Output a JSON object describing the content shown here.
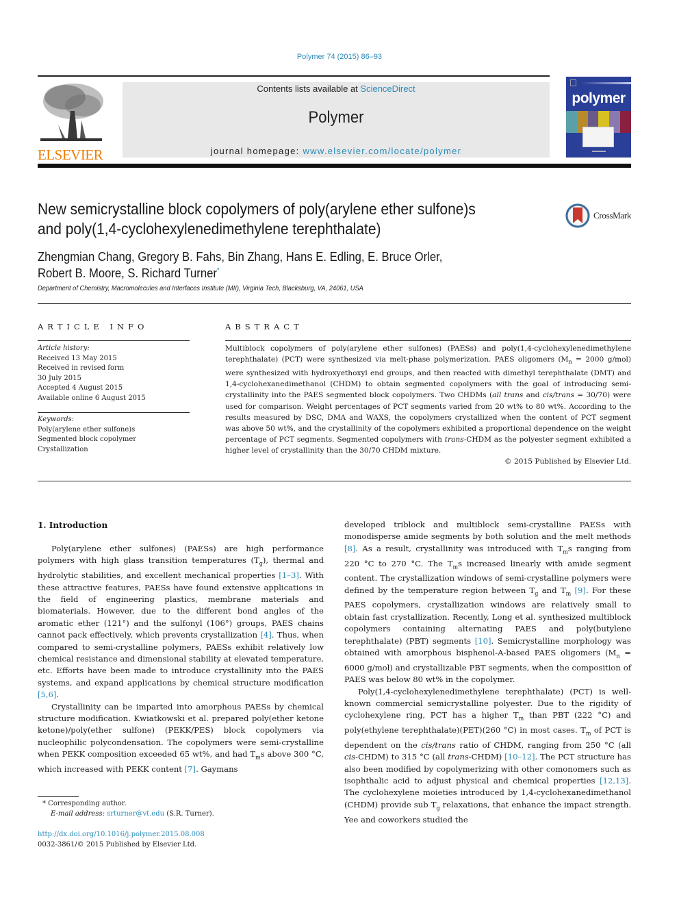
{
  "header": {
    "citation": "Polymer 74 (2015) 86–93",
    "contents_prefix": "Contents lists available at ",
    "contents_link": "ScienceDirect",
    "journal_name": "Polymer",
    "homepage_prefix": "journal homepage: ",
    "homepage_link": "www.elsevier.com/locate/polymer",
    "publisher_logo_text": "ELSEVIER",
    "cover_title": "polymer",
    "colors": {
      "link": "#2a8ab8",
      "elsevier_orange": "#f07d00",
      "cover_blue": "#2a3f98"
    }
  },
  "article": {
    "title_line1": "New semicrystalline block copolymers of poly(arylene ether sulfone)s",
    "title_line2": "and poly(1,4-cyclohexylenedimethylene terephthalate)",
    "crossmark_label": "CrossMark",
    "authors_line1": "Zhengmian Chang, Gregory B. Fahs, Bin Zhang, Hans E. Edling, E. Bruce Orler,",
    "authors_line2": "Robert B. Moore, S. Richard Turner",
    "corresponding_mark": "*",
    "affiliation": "Department of Chemistry, Macromolecules and Interfaces Institute (MII), Virginia Tech, Blacksburg, VA, 24061, USA"
  },
  "article_info": {
    "heading": "ARTICLE INFO",
    "history_label": "Article history:",
    "history": [
      "Received 13 May 2015",
      "Received in revised form",
      "30 July 2015",
      "Accepted 4 August 2015",
      "Available online 6 August 2015"
    ],
    "keywords_label": "Keywords:",
    "keywords": [
      "Poly(arylene ether sulfone)s",
      "Segmented block copolymer",
      "Crystallization"
    ]
  },
  "abstract": {
    "heading": "ABSTRACT",
    "p1": "Multiblock copolymers of poly(arylene ether sulfones) (PAESs) and poly(1,4-cyclohexylenedimethylene terephthalate) (PCT) were synthesized via melt-phase polymerization. PAES oligomers (M",
    "p1_sub": "n",
    "p2": " = 2000 g/mol) were synthesized with hydroxyethoxyl end groups, and then reacted with dimethyl terephthalate (DMT) and 1,4-cyclohexanedimethanol (CHDM) to obtain segmented copolymers with the goal of introducing semi-crystallinity into the PAES segmented block copolymers. Two CHDMs (",
    "p2_ital": "all trans",
    "p3": " and ",
    "p3_ital": "cis/trans",
    "p4": " = 30/70) were used for comparison. Weight percentages of PCT segments varied from 20 wt% to 80 wt%. According to the results measured by DSC, DMA and WAXS, the copolymers crystallized when the content of PCT segment was above 50 wt%, and the crystallinity of the copolymers exhibited a proportional dependence on the weight percentage of PCT segments. Segmented copolymers with ",
    "p4_ital": "trans",
    "p5": "-CHDM as the polyester segment exhibited a higher level of crystallinity than the 30/70 CHDM mixture.",
    "copyright": "© 2015 Published by Elsevier Ltd."
  },
  "body": {
    "section_heading": "1.  Introduction",
    "left": {
      "a1": "Poly(arylene ether sulfones) (PAESs) are high performance polymers with high glass transition temperatures (T",
      "a1_sub": "g",
      "a2": "), thermal and hydrolytic stabilities, and excellent mechanical properties ",
      "a2_ref": "[1–3]",
      "a3": ". With these attractive features, PAESs have found extensive applications in the field of engineering plastics, membrane materials and biomaterials. However, due to the different bond angles of the aromatic ether (121°) and the sulfonyl (106°) groups, PAES chains cannot pack effectively, which prevents crystallization ",
      "a3_ref": "[4]",
      "a4": ". Thus, when compared to semi-crystalline polymers, PAESs exhibit relatively low chemical resistance and dimensional stability at elevated temperature, etc. Efforts have been made to introduce crystallinity into the PAES systems, and expand applications by chemical structure modification ",
      "a4_ref": "[5,6]",
      "a5": ".",
      "b1": "Crystallinity can be imparted into amorphous PAESs by chemical structure modification. Kwiatkowski et al. prepared poly(ether ketone ketone)/poly(ether sulfone) (PEKK/PES) block copolymers via nucleophilic polycondensation. The copolymers were semi-crystalline when PEKK composition exceeded 65 wt%, and had T",
      "b1_sub": "m",
      "b2": "s above 300 °C, which increased with PEKK content ",
      "b2_ref": "[7]",
      "b3": ". Gaymans"
    },
    "right": {
      "a1": "developed triblock and multiblock semi-crystalline PAESs with monodisperse amide segments by both solution and the melt methods ",
      "a1_ref": "[8]",
      "a2": ". As a result, crystallinity was introduced with T",
      "a2_sub": "m",
      "a3": "s ranging from 220 °C to 270 °C. The T",
      "a3_sub": "m",
      "a4": "s increased linearly with amide segment content. The crystallization windows of semi-crystalline polymers were defined by the temperature region between T",
      "a4_sub": "g",
      "a5": " and T",
      "a5_sub": "m",
      "a5b": " ",
      "a5_ref": "[9]",
      "a6": ". For these PAES copolymers, crystallization windows are relatively small to obtain fast crystallization. Recently, Long et al. synthesized multiblock copolymers containing alternating PAES and poly(butylene terephthalate) (PBT) segments ",
      "a6_ref": "[10]",
      "a7": ". Semicrystalline morphology was obtained with amorphous bisphenol-A-based PAES oligomers (M",
      "a7_sub": "n",
      "a8": " = 6000 g/mol) and crystallizable PBT segments, when the composition of PAES was below 80 wt% in the copolymer.",
      "b1": "Poly(1,4-cyclohexylenedimethylene terephthalate) (PCT) is well-known commercial semicrystalline polyester. Due to the rigidity of cyclohexylene ring, PCT has a higher T",
      "b1_sub": "m",
      "b2": " than PBT (222 °C) and poly(ethylene terephthalate)(PET)(260 °C) in most cases. T",
      "b2_sub": "m",
      "b3": " of PCT is dependent on the ",
      "b3_ital": "cis/trans",
      "b4": " ratio of CHDM, ranging from 250 °C (all ",
      "b4_ital": "cis",
      "b5": "-CHDM) to 315 °C (all ",
      "b5_ital": "trans",
      "b6": "-CHDM) ",
      "b6_ref": "[10–12]",
      "b7": ". The PCT structure has also been modified by copolymerizing with other comonomers such as isophthalic acid to adjust physical and chemical properties ",
      "b7_ref": "[12,13]",
      "b8": ". The cyclohexylene moieties introduced by 1,4-cyclohexanedimethanol (CHDM) provide sub T",
      "b8_sub": "g",
      "b9": " relaxations, that enhance the impact strength. Yee and coworkers studied the"
    }
  },
  "footnote": {
    "mark": "*",
    "corresponding": " Corresponding author.",
    "email_label": "E-mail address:",
    "email": "srturner@vt.edu",
    "email_suffix": " (S.R. Turner).",
    "doi": "http://dx.doi.org/10.1016/j.polymer.2015.08.008",
    "issn_line": "0032-3861/© 2015 Published by Elsevier Ltd."
  }
}
